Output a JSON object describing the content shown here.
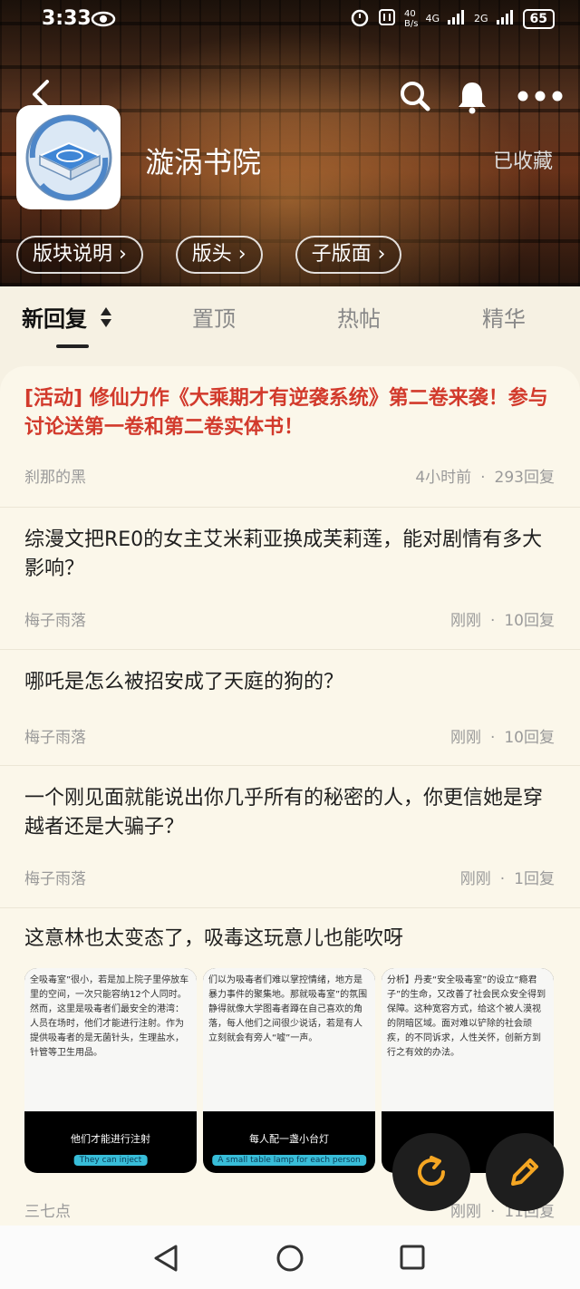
{
  "status_bar": {
    "time": "3:33",
    "net_speed_top": "40",
    "net_speed_bottom": "B/s",
    "net_type_1": "4G",
    "net_type_2": "2G",
    "battery": "65"
  },
  "header": {
    "board_name": "漩涡书院",
    "favorite_label": "已收藏"
  },
  "pills": [
    {
      "label": "版块说明 ›"
    },
    {
      "label": "版头 ›"
    },
    {
      "label": "子版面 ›"
    }
  ],
  "tabs": [
    {
      "label": "新回复",
      "active": true
    },
    {
      "label": "置顶"
    },
    {
      "label": "热帖"
    },
    {
      "label": "精华"
    }
  ],
  "posts": [
    {
      "title": "[活动] 修仙力作《大乘期才有逆袭系统》第二卷来袭！参与讨论送第一卷和第二卷实体书！",
      "author": "刹那的黑",
      "time": "4小时前",
      "replies": "293回复",
      "highlight": true
    },
    {
      "title": "综漫文把RE0的女主艾米莉亚换成芙莉莲，能对剧情有多大影响？",
      "author": "梅子雨落",
      "time": "刚刚",
      "replies": "10回复"
    },
    {
      "title": "哪吒是怎么被招安成了天庭的狗的？",
      "author": "梅子雨落",
      "time": "刚刚",
      "replies": "10回复"
    },
    {
      "title": "一个刚见面就能说出你几乎所有的秘密的人，你更信她是穿越者还是大骗子？",
      "author": "梅子雨落",
      "time": "刚刚",
      "replies": "1回复"
    },
    {
      "title": "这意林也太变态了，吸毒这玩意儿也能吹呀",
      "author": "三七点",
      "time": "刚刚",
      "replies": "11回复"
    }
  ],
  "thumbnails": [
    {
      "text": "全吸毒室”很小，若是加上院子里停放车里的空间，一次只能容纳12个人同时。然而，这里是吸毒者们最安全的港湾：人员在场时，他们才能进行注射。作为提供吸毒者的是无菌针头，生理盐水，针管等卫生用品。",
      "caption": "他们才能进行注射",
      "caption_en": "They can inject"
    },
    {
      "text": "们以为吸毒者们难以掌控情绪，地方是暴力事件的聚集地。那就吸毒室”的氛围静得就像大学图毒者蹲在自己喜欢的角落，每人他们之间很少说话，若是有人立刻就会有旁人“嘘”一声。",
      "caption": "每人配一盏小台灯",
      "caption_en": "A small table lamp for each person"
    },
    {
      "text": "分析】丹麦“安全吸毒室”的设立“瘾君子”的生命，又改善了社会民众安全得到保障。这种宽容方式，给这个被人漠视的阴暗区域。面对难以铲除的社会顽疾，的不同诉求，人性关怀，创新方到行之有效的办法。",
      "caption": "",
      "caption_en": ""
    }
  ]
}
